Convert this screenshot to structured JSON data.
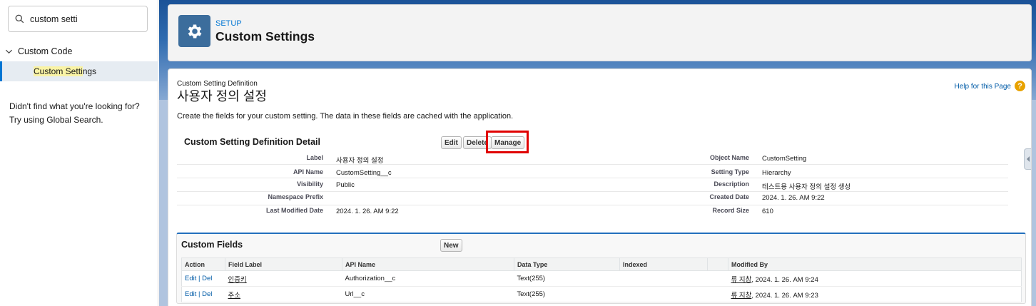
{
  "sidebar": {
    "search_value": "custom setti",
    "tree_parent_label": "Custom Code",
    "tree_child_highlight": "Custom Setti",
    "tree_child_rest": "ngs",
    "not_found_line1": "Didn't find what you're looking for?",
    "not_found_line2": "Try using Global Search."
  },
  "header": {
    "eyebrow": "SETUP",
    "title": "Custom Settings",
    "icon": "gear-icon"
  },
  "content": {
    "eyebrow": "Custom Setting Definition",
    "title": "사용자 정의 설정",
    "help_link": "Help for this Page",
    "help_icon_glyph": "?",
    "description": "Create the fields for your custom setting. The data in these fields are cached with the application."
  },
  "detail": {
    "title": "Custom Setting Definition Detail",
    "buttons": {
      "edit": "Edit",
      "delete": "Delete",
      "manage": "Manage"
    },
    "rows": [
      {
        "left_label": "Label",
        "left_value": "사용자 정의 설정",
        "right_label": "Object Name",
        "right_value": "CustomSetting"
      },
      {
        "left_label": "API Name",
        "left_value": "CustomSetting__c",
        "right_label": "Setting Type",
        "right_value": "Hierarchy"
      },
      {
        "left_label": "Visibility",
        "left_value": "Public",
        "right_label": "Description",
        "right_value": "테스트용 사용자 정의 설정 생성"
      },
      {
        "left_label": "Namespace Prefix",
        "left_value": "",
        "right_label": "Created Date",
        "right_value": "2024. 1. 26. AM 9:22"
      },
      {
        "left_label": "Last Modified Date",
        "left_value": "2024. 1. 26. AM 9:22",
        "right_label": "Record Size",
        "right_value": "610"
      }
    ]
  },
  "custom_fields": {
    "title": "Custom Fields",
    "new_button": "New",
    "columns": [
      "Action",
      "Field Label",
      "API Name",
      "Data Type",
      "Indexed",
      "",
      "Modified By"
    ],
    "rows": [
      {
        "edit": "Edit",
        "sep": " | ",
        "del": "Del",
        "field_label": "인증키",
        "api_name": "Authorization__c",
        "data_type": "Text(255)",
        "indexed": "",
        "modified_user": "류 지창",
        "modified_date": ", 2024. 1. 26. AM 9:24"
      },
      {
        "edit": "Edit",
        "sep": " | ",
        "del": "Del",
        "field_label": "주소",
        "api_name": "Url__c",
        "data_type": "Text(255)",
        "indexed": "",
        "modified_user": "류 지창",
        "modified_date": ", 2024. 1. 26. AM 9:23"
      }
    ]
  },
  "colors": {
    "brand_blue": "#0176d3",
    "header_icon_bg": "#3c6d9c",
    "highlight_red": "#e00000",
    "help_icon_bg": "#e8a200"
  }
}
